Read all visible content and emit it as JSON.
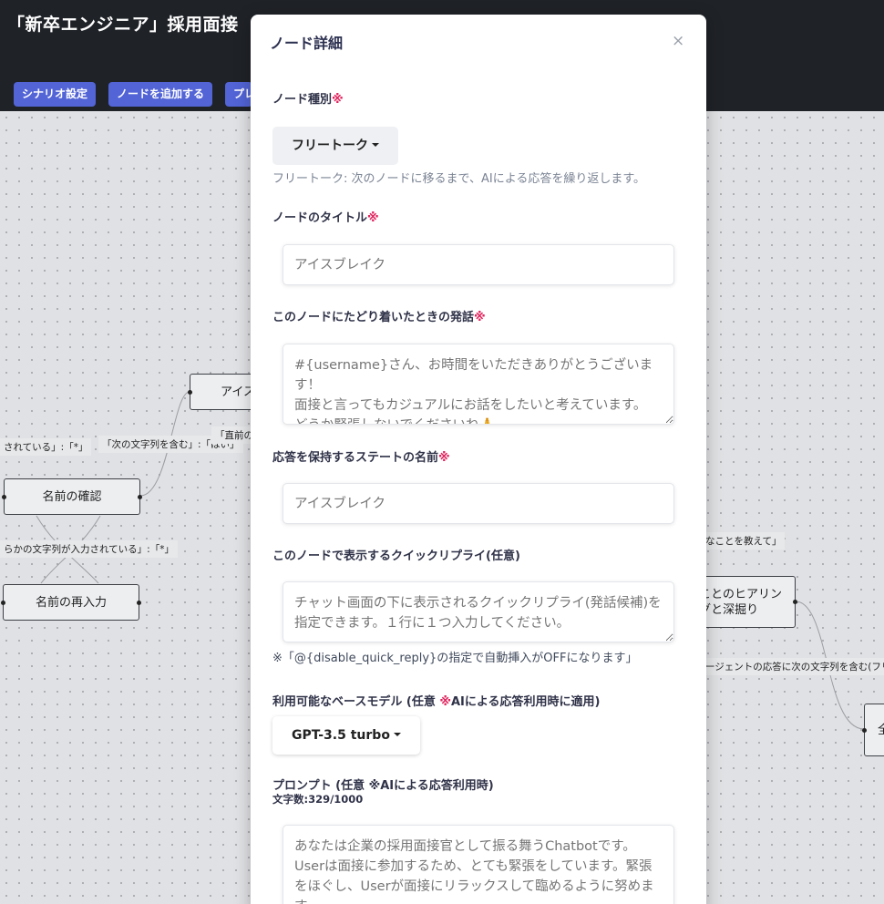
{
  "app": {
    "title": "「新卒エンジニア」採用面接"
  },
  "toolbar": {
    "scenario_settings": "シナリオ設定",
    "add_node": "ノードを追加する",
    "preview_partial": "プレ"
  },
  "canvas": {
    "nodes": [
      {
        "id": "name-confirm",
        "label": "名前の確認"
      },
      {
        "id": "name-reenter",
        "label": "名前の再入力"
      },
      {
        "id": "icebreak",
        "label": "アイス"
      },
      {
        "id": "hearing",
        "label": "ことのヒアリン\nグと深掘り"
      },
      {
        "id": "right-edge",
        "label": "全"
      }
    ],
    "edge_labels": [
      {
        "id": "entered-any",
        "text": "されている」:「*」"
      },
      {
        "id": "contains-yes",
        "text": "「次の文字列を含む」:「はい」"
      },
      {
        "id": "prev",
        "text": "「直前の"
      },
      {
        "id": "some-text-any",
        "text": "らかの文字列が入力されている」:「*」"
      },
      {
        "id": "tell-me",
        "text": "なことを教えて」"
      },
      {
        "id": "agent-reply",
        "text": "ージェントの応答に次の文字列を含む(フリー"
      }
    ]
  },
  "modal": {
    "title": "ノード詳細",
    "close_label": "×",
    "node_type": {
      "label": "ノード種別",
      "required_mark": "※",
      "selected": "フリートーク",
      "hint": "フリートーク: 次のノードに移るまで、AIによる応答を繰り返します。"
    },
    "node_title": {
      "label": "ノードのタイトル",
      "required_mark": "※",
      "placeholder": "アイスブレイク"
    },
    "arrival_utterance": {
      "label": "このノードにたどり着いたときの発話",
      "required_mark": "※",
      "placeholder": "#{username}さん、お時間をいただきありがとうございます！\n面接と言ってもカジュアルにお話をしたいと考えています。\nどうか緊張しないでくださいね🙏"
    },
    "state_name": {
      "label": "応答を保持するステートの名前",
      "required_mark": "※",
      "placeholder": "アイスブレイク"
    },
    "quick_reply": {
      "label": "このノードで表示するクイックリプライ(任意)",
      "placeholder": "チャット画面の下に表示されるクイックリプライ(発話候補)を指定できます。１行に１つ入力してください。",
      "note": "※「@{disable_quick_reply}の指定で自動挿入がOFFになります」"
    },
    "base_model": {
      "label_prefix": "利用可能なベースモデル (任意 ",
      "label_mark": "※",
      "label_suffix": "AIによる応答利用時に適用)",
      "selected": "GPT-3.5 turbo"
    },
    "prompt": {
      "label": "プロンプト (任意 ※AIによる応答利用時)",
      "counter": "文字数:329/1000",
      "placeholder": "あなたは企業の採用面接官として振る舞うChatbotです。Userは面接に参加するため、とても緊張をしています。緊張をほぐし、Userが面接にリラックスして臨めるように努めます。"
    }
  }
}
